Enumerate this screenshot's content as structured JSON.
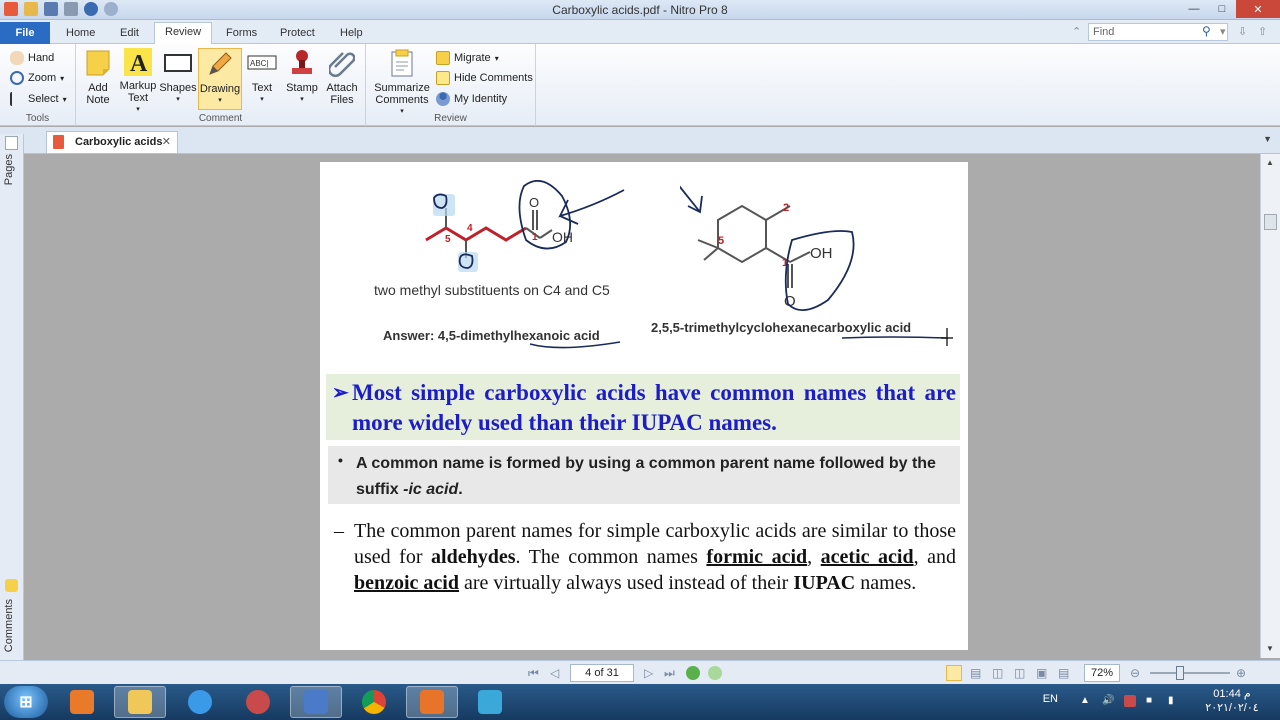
{
  "window": {
    "title": "Carboxylic acids.pdf - Nitro Pro 8"
  },
  "menu": {
    "file": "File",
    "tabs": [
      "Home",
      "Edit",
      "Review",
      "Forms",
      "Protect",
      "Help"
    ],
    "find_placeholder": "Find"
  },
  "ribbon": {
    "tools": {
      "hand": "Hand",
      "zoom": "Zoom",
      "select": "Select",
      "label": "Tools"
    },
    "comment": {
      "add_note": "Add Note",
      "markup_text": "Markup Text",
      "shapes": "Shapes",
      "drawing": "Drawing",
      "text": "Text",
      "stamp": "Stamp",
      "attach_files": "Attach Files",
      "label": "Comment"
    },
    "review": {
      "summarize": "Summarize Comments",
      "migrate": "Migrate",
      "hide_comments": "Hide Comments",
      "my_identity": "My Identity",
      "label": "Review"
    }
  },
  "doc_tab": {
    "label": "Carboxylic acids"
  },
  "side_panel": {
    "pages": "Pages",
    "comments": "Comments"
  },
  "page": {
    "left_structure": {
      "numbers": [
        "5",
        "4",
        "1"
      ],
      "carbonyl_o": "O",
      "hydroxyl": "OH",
      "caption": "two methyl substituents on C4 and C5",
      "answer": "Answer: 4,5-dimethylhexanoic acid"
    },
    "right_structure": {
      "numbers": [
        "2",
        "5",
        "1"
      ],
      "hydroxyl": "OH",
      "carbonyl_o": "O",
      "name": "2,5,5-trimethylcyclohexanecarboxylic acid"
    },
    "heading_bullet": "➢",
    "heading": "Most simple carboxylic acids have common names that are more widely used than their IUPAC names.",
    "bullet": {
      "marker": "•",
      "text_plain": "A common name is formed by using a common parent name followed by the suffix ",
      "text_italic": "-ic acid",
      "text_end": "."
    },
    "para": {
      "dash": "–",
      "p1": "The common parent names for simple carboxylic acids are similar to those used for ",
      "aldehydes": "aldehydes",
      "p2": ". The common names ",
      "formic": "formic acid",
      "comma": ", ",
      "acetic": "acetic acid",
      "p3": ", and ",
      "benzoic": "benzoic acid",
      "p4": " are virtually always used instead of their ",
      "iupac": "IUPAC",
      "p5": " names."
    }
  },
  "status": {
    "page_indicator": "4 of 31",
    "zoom": "72%"
  },
  "taskbar": {
    "lang": "EN",
    "time": "01:44 م",
    "date": "٢٠٢١/٠٢/٠٤"
  },
  "colors": {
    "heading_blue": "#1c1cc8",
    "heading_bg": "#e6efdc",
    "bullet_bg": "#e8e8e8",
    "chain_red": "#c0202a",
    "accent": "#2a6cc4"
  }
}
